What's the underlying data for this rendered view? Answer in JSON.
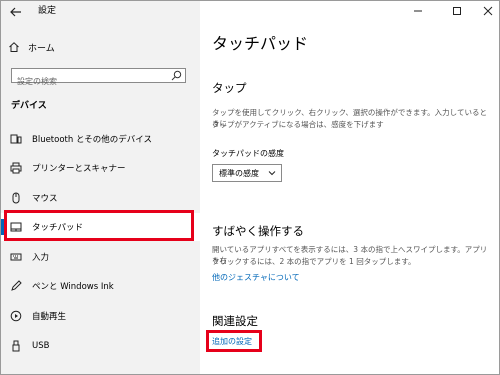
{
  "app": {
    "title": "設定"
  },
  "sidebar": {
    "home_label": "ホーム",
    "search_placeholder": "設定の検索",
    "section": "デバイス",
    "items": [
      {
        "label": "Bluetooth とその他のデバイス",
        "icon": "bluetooth-devices-icon"
      },
      {
        "label": "プリンターとスキャナー",
        "icon": "printer-icon"
      },
      {
        "label": "マウス",
        "icon": "mouse-icon"
      },
      {
        "label": "タッチパッド",
        "icon": "touchpad-icon",
        "selected": true
      },
      {
        "label": "入力",
        "icon": "keyboard-icon"
      },
      {
        "label": "ペンと Windows Ink",
        "icon": "pen-icon"
      },
      {
        "label": "自動再生",
        "icon": "autoplay-icon"
      },
      {
        "label": "USB",
        "icon": "usb-icon"
      }
    ]
  },
  "main": {
    "title": "タッチパッド",
    "tap": {
      "heading": "タップ",
      "description_line1": "タップを使用してクリック、右クリック、選択の操作ができます。入力しているときに",
      "description_line2": "タップがアクティブになる場合は、感度を下げます",
      "sensitivity_label": "タッチパッドの感度",
      "sensitivity_value": "標準の感度"
    },
    "gestures": {
      "heading": "すばやく操作する",
      "description_line1": "開いているアプリすべてを表示するには、3 本の指で上へスワイプします。アプリを右",
      "description_line2": "クリックするには、2 本の指でアプリを 1 回タップします。",
      "link": "他のジェスチャについて"
    },
    "related": {
      "heading": "関連設定",
      "link": "追加の設定"
    }
  },
  "colors": {
    "accent": "#0067b8",
    "highlight": "#e6001a",
    "sidebar_bg": "#f2f2f2"
  }
}
